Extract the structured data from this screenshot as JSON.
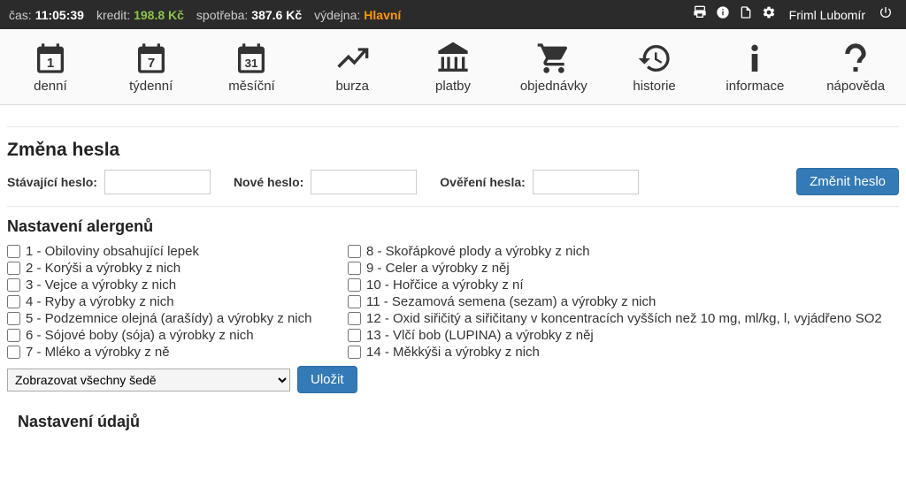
{
  "topbar": {
    "time_label": "čas:",
    "time_value": "11:05:39",
    "credit_label": "kredit:",
    "credit_value": "198.8 Kč",
    "spend_label": "spotřeba:",
    "spend_value": "387.6 Kč",
    "outlet_label": "výdejna:",
    "outlet_value": "Hlavní",
    "user": "Friml Lubomír"
  },
  "nav": {
    "daily": "denní",
    "weekly": "týdenní",
    "monthly": "měsíční",
    "burza": "burza",
    "payments": "platby",
    "orders": "objednávky",
    "history": "historie",
    "info": "informace",
    "help": "nápověda"
  },
  "password": {
    "title": "Změna hesla",
    "current_label": "Stávající heslo:",
    "new_label": "Nové heslo:",
    "confirm_label": "Ověření hesla:",
    "button": "Změnit heslo"
  },
  "allergens": {
    "title": "Nastavení alergenů",
    "col1": [
      "1 - Obiloviny obsahující lepek",
      "2 - Korýši a výrobky z nich",
      "3 - Vejce a výrobky z nich",
      "4 - Ryby a výrobky z nich",
      "5 - Podzemnice olejná (arašídy) a výrobky z nich",
      "6 - Sójové boby (sója) a výrobky z nich",
      "7 - Mléko a výrobky z ně"
    ],
    "col2": [
      "8 - Skořápkové plody a výrobky z nich",
      "9 - Celer a výrobky z něj",
      "10 - Hořčice a výrobky z ní",
      "11 - Sezamová semena (sezam) a výrobky z nich",
      "12 - Oxid siřičitý a siřičitany v koncentracích vyšších než 10 mg, ml/kg, l, vyjádřeno SO2",
      "13 - Vlčí bob (LUPINA) a výrobky z něj",
      "14 - Měkkýši a výrobky z nich"
    ],
    "select_value": "Zobrazovat všechny šedě",
    "save_button": "Uložit"
  },
  "data_settings": {
    "title": "Nastavení údajů"
  }
}
